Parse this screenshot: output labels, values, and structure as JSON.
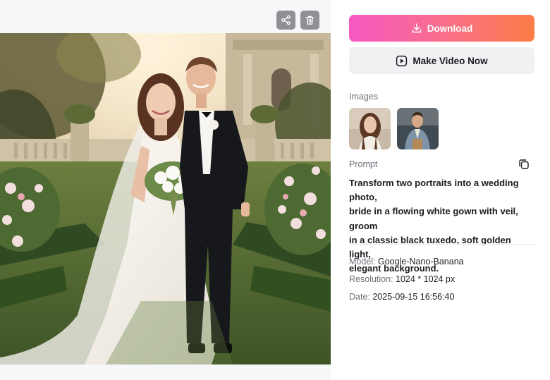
{
  "toolbar": {
    "share_icon": "share-icon",
    "delete_icon": "trash-icon"
  },
  "preview": {
    "alt": "Bride in a white gown with veil and groom in a black tuxedo in a sunlit garden"
  },
  "actions": {
    "download_label": "Download",
    "download_icon": "download-icon",
    "make_video_label": "Make Video Now",
    "make_video_icon": "play-square-icon"
  },
  "images": {
    "label": "Images",
    "thumbnails": [
      {
        "alt": "Portrait of a woman with long brown hair"
      },
      {
        "alt": "Portrait of a man in a denim jacket"
      }
    ]
  },
  "prompt": {
    "label": "Prompt",
    "copy_icon": "copy-icon",
    "lines": [
      "Transform two portraits into a wedding photo,",
      "bride in a flowing white gown with veil, groom",
      "in a classic black tuxedo, soft golden light,",
      "elegant background."
    ]
  },
  "meta": {
    "model_key": "Model:",
    "model_value": "Google-Nano-Banana",
    "resolution_key": "Resolution:",
    "resolution_value": "1024 * 1024 px",
    "date_key": "Date:",
    "date_value": "2025-09-15 16:56:40"
  },
  "colors": {
    "download_gradient_start": "#f659c3",
    "download_gradient_end": "#fb7d46",
    "secondary_button_bg": "#f1f1f4",
    "label_gray": "#6e7079"
  }
}
